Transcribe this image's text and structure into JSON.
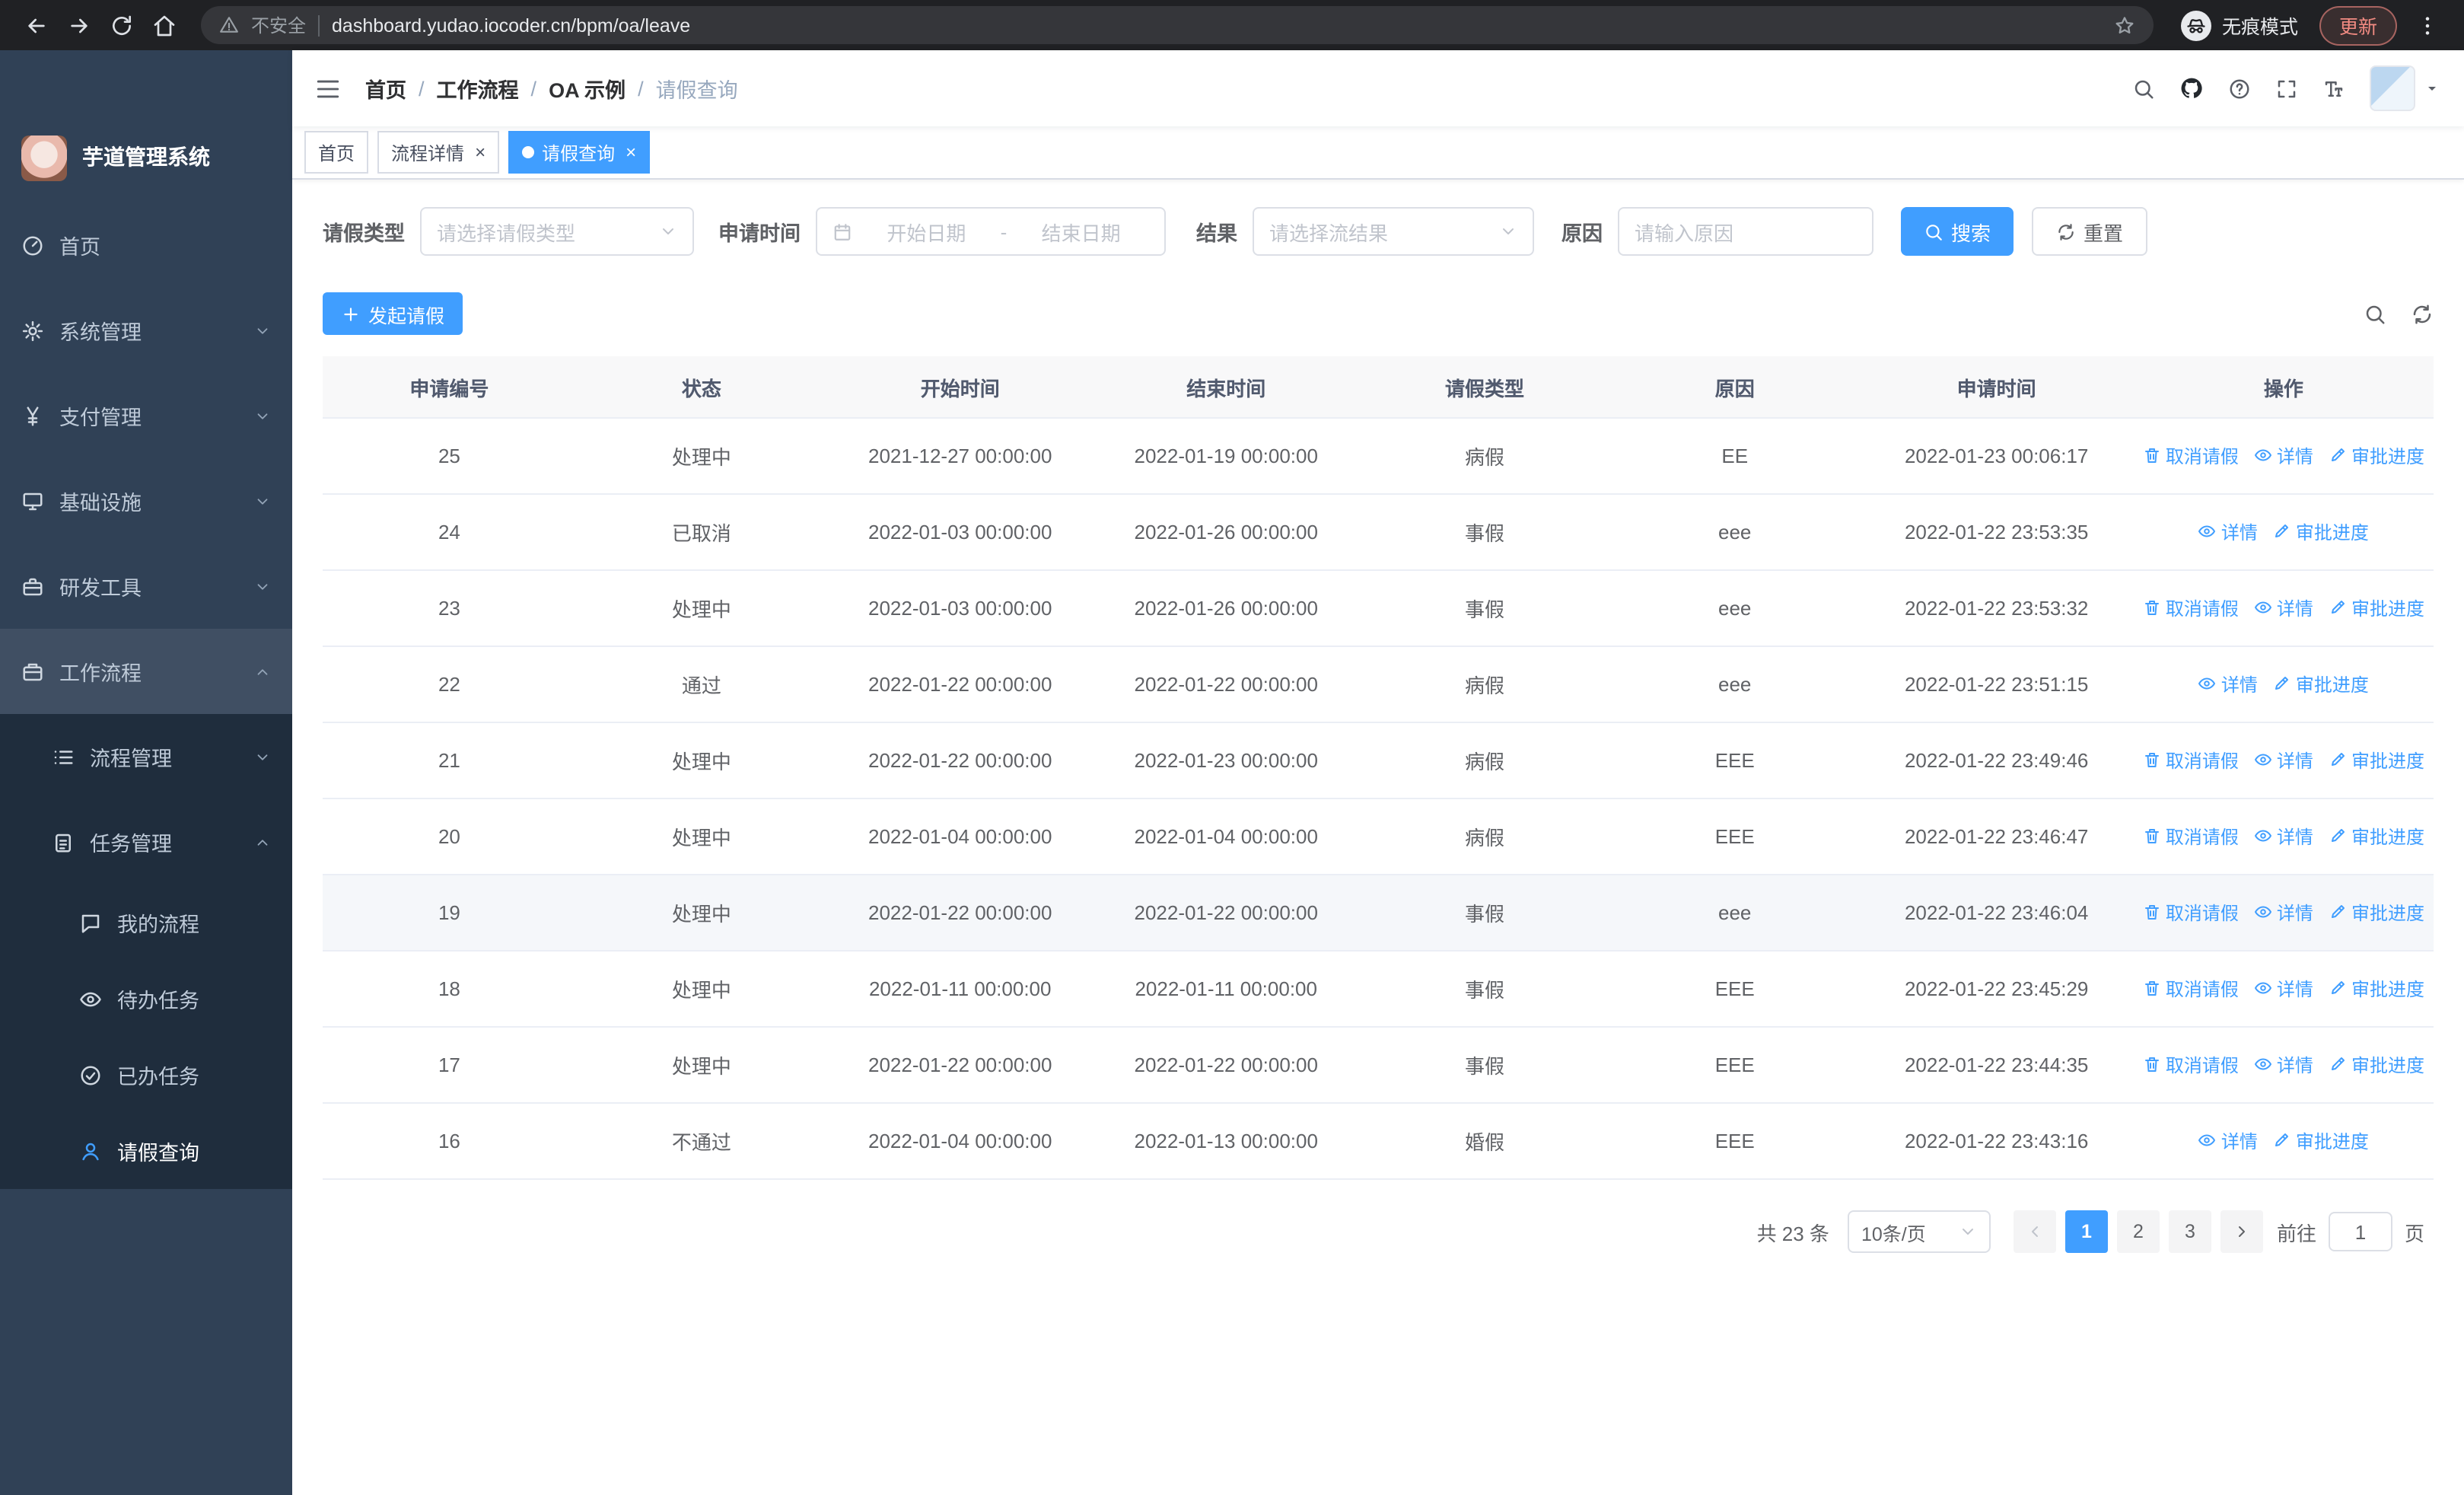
{
  "browser": {
    "security_label": "不安全",
    "url": "dashboard.yudao.iocoder.cn/bpm/oa/leave",
    "incognito_label": "无痕模式",
    "update_label": "更新"
  },
  "sidebar": {
    "logo_title": "芋道管理系统",
    "menu": [
      {
        "label": "首页",
        "icon": "dashboard-icon",
        "level": 1
      },
      {
        "label": "系统管理",
        "icon": "gear-icon",
        "level": 1,
        "arrow": "down"
      },
      {
        "label": "支付管理",
        "icon": "yen-icon",
        "level": 1,
        "arrow": "down"
      },
      {
        "label": "基础设施",
        "icon": "monitor-icon",
        "level": 1,
        "arrow": "down"
      },
      {
        "label": "研发工具",
        "icon": "toolbox-icon",
        "level": 1,
        "arrow": "down"
      },
      {
        "label": "工作流程",
        "icon": "workflow-icon",
        "level": 1,
        "arrow": "up",
        "opened": true
      },
      {
        "label": "流程管理",
        "icon": "list-icon",
        "level": 2,
        "arrow": "down"
      },
      {
        "label": "任务管理",
        "icon": "tasks-icon",
        "level": 2,
        "arrow": "up"
      },
      {
        "label": "我的流程",
        "icon": "chat-icon",
        "level": 3
      },
      {
        "label": "待办任务",
        "icon": "eye-icon",
        "level": 3
      },
      {
        "label": "已办任务",
        "icon": "check-icon",
        "level": 3
      },
      {
        "label": "请假查询",
        "icon": "user-icon",
        "level": 3,
        "active": true
      }
    ]
  },
  "navbar": {
    "breadcrumb": [
      "首页",
      "工作流程",
      "OA 示例",
      "请假查询"
    ]
  },
  "tags": [
    {
      "label": "首页"
    },
    {
      "label": "流程详情",
      "closable": true
    },
    {
      "label": "请假查询",
      "closable": true,
      "active": true
    }
  ],
  "filters": {
    "leave_type_label": "请假类型",
    "leave_type_placeholder": "请选择请假类型",
    "apply_time_label": "申请时间",
    "date_start_placeholder": "开始日期",
    "date_separator": "-",
    "date_end_placeholder": "结束日期",
    "result_label": "结果",
    "result_placeholder": "请选择流结果",
    "reason_label": "原因",
    "reason_placeholder": "请输入原因",
    "search_label": "搜索",
    "reset_label": "重置"
  },
  "toolbar": {
    "create_label": "发起请假"
  },
  "table": {
    "columns": [
      "申请编号",
      "状态",
      "开始时间",
      "结束时间",
      "请假类型",
      "原因",
      "申请时间",
      "操作"
    ],
    "action_labels": {
      "cancel": "取消请假",
      "detail": "详情",
      "progress": "审批进度"
    },
    "rows": [
      {
        "id": "25",
        "status": "处理中",
        "start": "2021-12-27 00:00:00",
        "end": "2022-01-19 00:00:00",
        "type": "病假",
        "reason": "EE",
        "applied": "2022-01-23 00:06:17",
        "cancelable": true
      },
      {
        "id": "24",
        "status": "已取消",
        "start": "2022-01-03 00:00:00",
        "end": "2022-01-26 00:00:00",
        "type": "事假",
        "reason": "eee",
        "applied": "2022-01-22 23:53:35",
        "cancelable": false
      },
      {
        "id": "23",
        "status": "处理中",
        "start": "2022-01-03 00:00:00",
        "end": "2022-01-26 00:00:00",
        "type": "事假",
        "reason": "eee",
        "applied": "2022-01-22 23:53:32",
        "cancelable": true
      },
      {
        "id": "22",
        "status": "通过",
        "start": "2022-01-22 00:00:00",
        "end": "2022-01-22 00:00:00",
        "type": "病假",
        "reason": "eee",
        "applied": "2022-01-22 23:51:15",
        "cancelable": false
      },
      {
        "id": "21",
        "status": "处理中",
        "start": "2022-01-22 00:00:00",
        "end": "2022-01-23 00:00:00",
        "type": "病假",
        "reason": "EEE",
        "applied": "2022-01-22 23:49:46",
        "cancelable": true
      },
      {
        "id": "20",
        "status": "处理中",
        "start": "2022-01-04 00:00:00",
        "end": "2022-01-04 00:00:00",
        "type": "病假",
        "reason": "EEE",
        "applied": "2022-01-22 23:46:47",
        "cancelable": true
      },
      {
        "id": "19",
        "status": "处理中",
        "start": "2022-01-22 00:00:00",
        "end": "2022-01-22 00:00:00",
        "type": "事假",
        "reason": "eee",
        "applied": "2022-01-22 23:46:04",
        "cancelable": true,
        "hover": true
      },
      {
        "id": "18",
        "status": "处理中",
        "start": "2022-01-11 00:00:00",
        "end": "2022-01-11 00:00:00",
        "type": "事假",
        "reason": "EEE",
        "applied": "2022-01-22 23:45:29",
        "cancelable": true
      },
      {
        "id": "17",
        "status": "处理中",
        "start": "2022-01-22 00:00:00",
        "end": "2022-01-22 00:00:00",
        "type": "事假",
        "reason": "EEE",
        "applied": "2022-01-22 23:44:35",
        "cancelable": true
      },
      {
        "id": "16",
        "status": "不通过",
        "start": "2022-01-04 00:00:00",
        "end": "2022-01-13 00:00:00",
        "type": "婚假",
        "reason": "EEE",
        "applied": "2022-01-22 23:43:16",
        "cancelable": false
      }
    ]
  },
  "pagination": {
    "total": "共 23 条",
    "page_size": "10条/页",
    "pages": [
      "1",
      "2",
      "3"
    ],
    "active_page": "1",
    "goto_label": "前往",
    "goto_value": "1",
    "unit_label": "页"
  },
  "colors": {
    "accent": "#409eff",
    "sidebar_bg": "#304156",
    "sidebar_sub_bg": "#1f2d3d"
  }
}
